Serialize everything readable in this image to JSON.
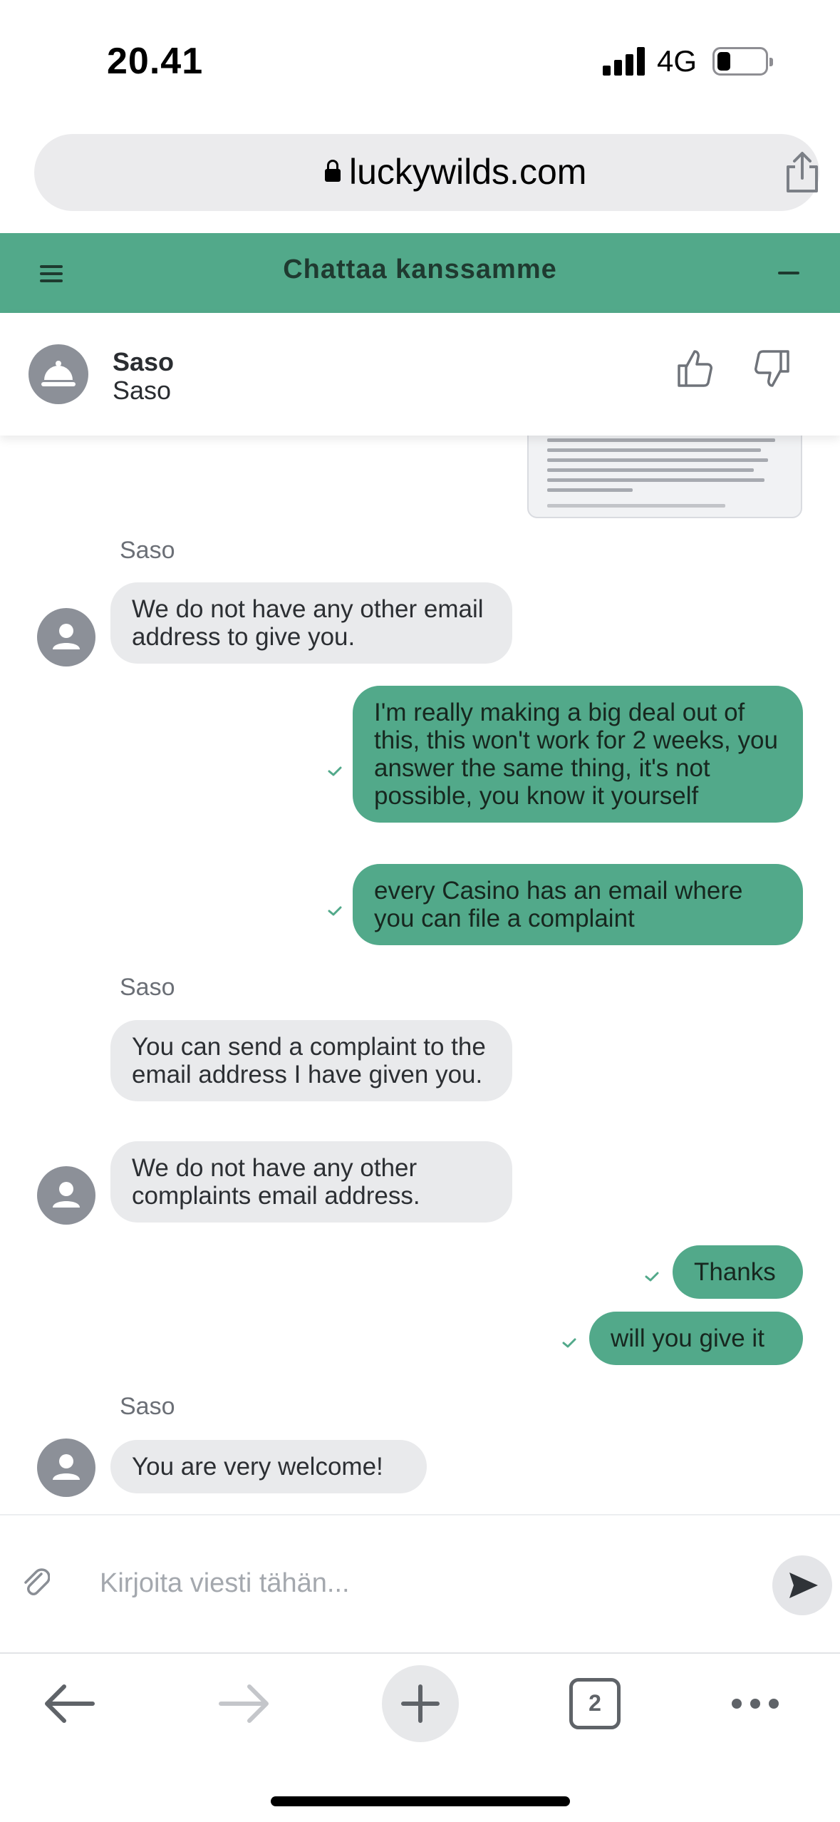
{
  "status_bar": {
    "time": "20.41",
    "network": "4G"
  },
  "browser": {
    "url": "luckywilds.com",
    "tabs_count": "2"
  },
  "chat": {
    "title": "Chattaa kanssamme",
    "agent": {
      "name": "Saso",
      "subtitle": "Saso"
    },
    "messages": [
      {
        "type": "sender",
        "text": "Saso"
      },
      {
        "type": "in",
        "text": "We do not have any other email address to give you."
      },
      {
        "type": "out",
        "text": "I'm really making a big deal out of this, this won't work for 2 weeks, you answer the same thing, it's not possible, you know it yourself"
      },
      {
        "type": "out",
        "text": "every Casino has an email where you can file a complaint"
      },
      {
        "type": "sender",
        "text": "Saso"
      },
      {
        "type": "in",
        "text": "You can send a complaint to the email address I have given you."
      },
      {
        "type": "in",
        "text": "We do not have any other complaints email address."
      },
      {
        "type": "out",
        "text": "Thanks"
      },
      {
        "type": "out",
        "text": "will you give it"
      },
      {
        "type": "sender",
        "text": "Saso"
      },
      {
        "type": "in",
        "text": "You are very welcome!"
      }
    ],
    "input_placeholder": "Kirjoita viesti tähän..."
  },
  "colors": {
    "brand_green": "#52a98a",
    "incoming_bubble": "#e9eaec",
    "avatar_gray": "#8c9098"
  },
  "icons": [
    "menu-icon",
    "minimize-icon",
    "bell-icon",
    "thumbs-up-icon",
    "thumbs-down-icon",
    "user-icon",
    "check-icon",
    "paperclip-icon",
    "send-icon",
    "back-arrow-icon",
    "forward-arrow-icon",
    "plus-icon",
    "more-icon",
    "share-icon",
    "lock-icon"
  ]
}
